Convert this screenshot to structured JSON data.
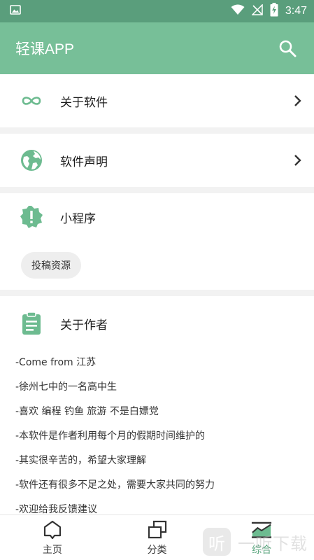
{
  "status_bar": {
    "time": "3:47"
  },
  "app_bar": {
    "title": "轻课APP"
  },
  "menu": {
    "about_software": "关于软件",
    "software_statement": "软件声明",
    "mini_program": "小程序",
    "submit_resource": "投稿资源",
    "about_author": "关于作者"
  },
  "author_lines": [
    "-Come from 江苏",
    "-徐州七中的一名高中生",
    "-喜欢 编程 钓鱼 旅游 不是白嫖党",
    "-本软件是作者利用每个月的假期时间维护的",
    "-其实很辛苦的，希望大家理解",
    "-软件还有很多不足之处，需要大家共同的努力",
    "-欢迎给我反馈建议"
  ],
  "bottom_nav": [
    {
      "label": "主页"
    },
    {
      "label": "分类"
    },
    {
      "label": "综合"
    }
  ],
  "watermark": {
    "logo": "听",
    "text": "一听下载"
  },
  "colors": {
    "status_bar": "#5a9e7c",
    "app_bar": "#77bf98",
    "accent": "#6dbb90",
    "active_label": "#5aa67e"
  }
}
